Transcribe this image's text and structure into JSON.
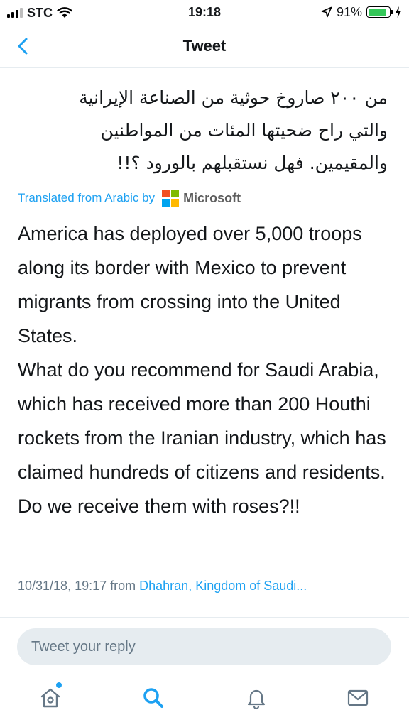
{
  "status_bar": {
    "carrier": "STC",
    "time": "19:18",
    "battery_percent": "91%",
    "battery_level": 0.91,
    "battery_color": "#34c759"
  },
  "nav": {
    "back_icon": "chevron-left-icon",
    "title": "Tweet"
  },
  "tweet": {
    "arabic_lines": [
      "من ٢٠٠ صاروخ حوثية من الصناعة الإيرانية",
      "والتي راح ضحيتها المئات من المواطنين",
      "والمقيمين. فهل نستقبلهم بالورود ؟!!"
    ],
    "translated_from": "Translated from Arabic by",
    "translator_name": "Microsoft",
    "translation": "America has deployed over 5,000 troops along its border with Mexico to prevent migrants from crossing into the United States.\nWhat do you recommend for Saudi Arabia, which has received more than 200 Houthi rockets from the Iranian industry, which has claimed hundreds of citizens and residents. Do we receive them with roses?!!",
    "timestamp": "10/31/18, 19:17 from",
    "location": "Dhahran, Kingdom of Saudi..."
  },
  "reply": {
    "placeholder": "Tweet your reply"
  },
  "tabbar": {
    "items": [
      {
        "icon": "home-icon",
        "has_notification_dot": true
      },
      {
        "icon": "search-icon",
        "active": true
      },
      {
        "icon": "bell-icon"
      },
      {
        "icon": "mail-icon"
      }
    ]
  },
  "colors": {
    "accent": "#1da1f2",
    "text": "#14171a",
    "muted": "#657786"
  }
}
